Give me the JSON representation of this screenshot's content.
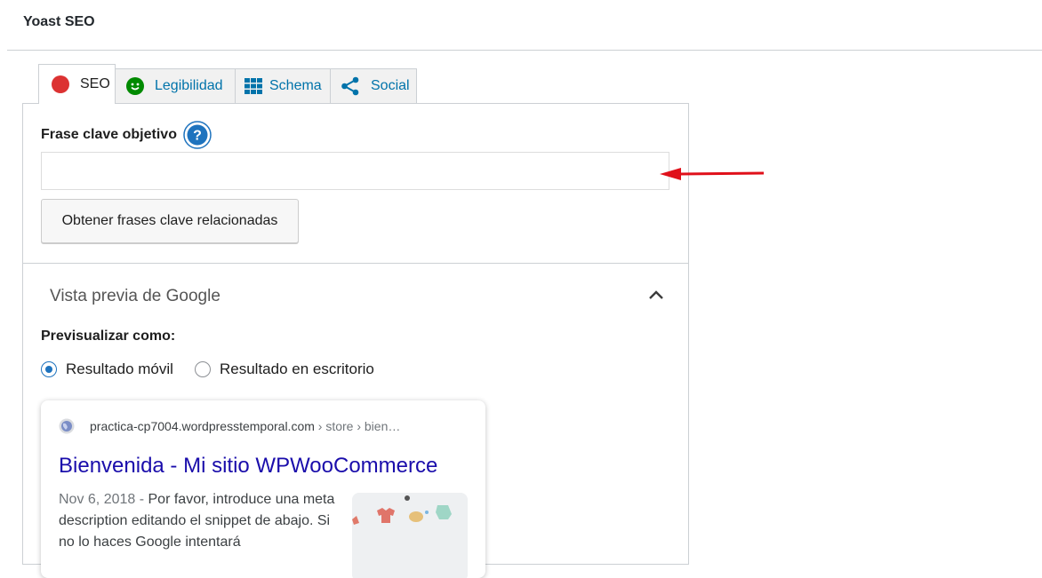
{
  "header": {
    "title": "Yoast SEO"
  },
  "tabs": [
    {
      "label": "SEO",
      "icon": "red-circle-icon",
      "color": "#dc3232"
    },
    {
      "label": "Legibilidad",
      "icon": "smiley-icon",
      "color": "#008a00"
    },
    {
      "label": "Schema",
      "icon": "grid-icon",
      "color": "#0073aa"
    },
    {
      "label": "Social",
      "icon": "share-icon",
      "color": "#0073aa"
    }
  ],
  "focus_keyphrase": {
    "label": "Frase clave objetivo",
    "value": "",
    "related_button": "Obtener frases clave relacionadas"
  },
  "google_preview": {
    "title": "Vista previa de Google",
    "preview_as_label": "Previsualizar como:",
    "options": [
      "Resultado móvil",
      "Resultado en escritorio"
    ],
    "selected": "Resultado móvil"
  },
  "serp": {
    "url_domain": "practica-cp7004.wordpresstemporal.com",
    "url_path": " › store › bien…",
    "title": "Bienvenida - Mi sitio WPWooCommerce",
    "date": "Nov 6, 2018",
    "separator": " - ",
    "description": "Por favor, introduce una meta description editando el snippet de abajo. Si no lo haces Google intentará"
  },
  "colors": {
    "link": "#1a0dab",
    "accent": "#0073aa",
    "arrow": "#e0101a"
  }
}
